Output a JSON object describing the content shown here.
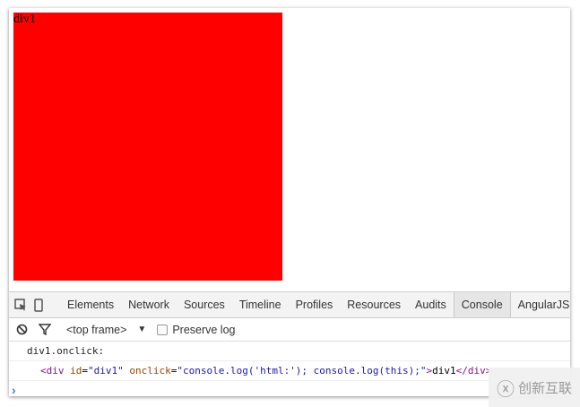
{
  "page": {
    "div_text": "div1",
    "div_color": "#ff0000"
  },
  "devtools": {
    "tabs": [
      "Elements",
      "Network",
      "Sources",
      "Timeline",
      "Profiles",
      "Resources",
      "Audits",
      "Console",
      "AngularJS"
    ],
    "active_tab": "Console",
    "frame_select": "<top frame>",
    "preserve_log": "Preserve log",
    "messages": {
      "line1": "div1.onclick:",
      "open_tag": "<div",
      "id_attr": "id",
      "id_val": "\"div1\"",
      "onclick_attr": "onclick",
      "onclick_val": "\"console.log('html:'); console.log(this);\"",
      "inner": "div1",
      "close_tag": "</div>"
    },
    "prompt": "›"
  },
  "watermark": {
    "text": "创新互联"
  }
}
